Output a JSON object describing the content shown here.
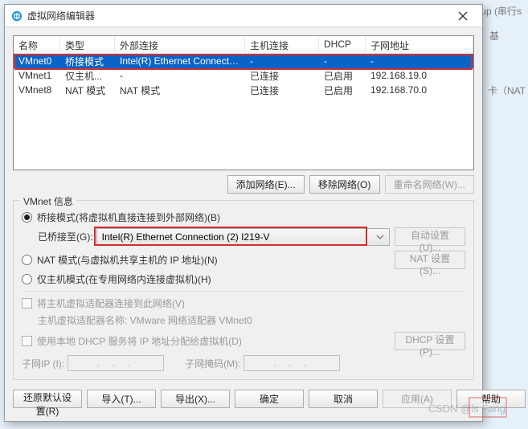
{
  "background": {
    "right_top": "up (串行s",
    "right_top2": "基",
    "right_mid": "卡（NAT"
  },
  "dialog_title": "虚拟网络编辑器",
  "columns": {
    "c1": "名称",
    "c2": "类型",
    "c3": "外部连接",
    "c4": "主机连接",
    "c5": "DHCP",
    "c6": "子网地址"
  },
  "rows": [
    {
      "name": "VMnet0",
      "type": "桥接模式",
      "ext": "Intel(R) Ethernet Connectio...",
      "host": "-",
      "dhcp": "-",
      "subnet": "-",
      "selected": true
    },
    {
      "name": "VMnet1",
      "type": "仅主机...",
      "ext": "-",
      "host": "已连接",
      "dhcp": "已启用",
      "subnet": "192.168.19.0"
    },
    {
      "name": "VMnet8",
      "type": "NAT 模式",
      "ext": "NAT 模式",
      "host": "已连接",
      "dhcp": "已启用",
      "subnet": "192.168.70.0"
    }
  ],
  "grid_buttons": {
    "add": "添加网络(E)...",
    "remove": "移除网络(O)",
    "rename": "重命名网络(W)..."
  },
  "fieldset_title": "VMnet 信息",
  "radios": {
    "bridged": "桥接模式(将虚拟机直接连接到外部网络)(B)",
    "nat": "NAT 模式(与虚拟机共享主机的 IP 地址)(N)",
    "hostonly": "仅主机模式(在专用网络内连接虚拟机)(H)"
  },
  "bridged_to_label": "已桥接至(G):",
  "bridged_to_value": "Intel(R) Ethernet Connection (2) I219-V",
  "auto_settings": "自动设置(U)...",
  "nat_settings": "NAT 设置(S)...",
  "chk_host_adapter": "将主机虚拟适配器连接到此网络(V)",
  "host_adapter_name_lbl": "主机虚拟适配器名称: VMware 网络适配器 VMnet0",
  "chk_dhcp": "使用本地 DHCP 服务将 IP 地址分配给虚拟机(D)",
  "dhcp_settings": "DHCP 设置(P)...",
  "subnet_ip_lbl": "子网IP (I):",
  "subnet_mask_lbl": "子网掩码(M):",
  "ip_dots": ". . .",
  "bottom": {
    "restore": "还原默认设置(R)",
    "import": "导入(T)...",
    "export": "导出(X)...",
    "ok": "确定",
    "cancel": "取消",
    "apply": "应用(A)",
    "help": "帮助"
  },
  "watermark": "CSDN @ls Fang"
}
